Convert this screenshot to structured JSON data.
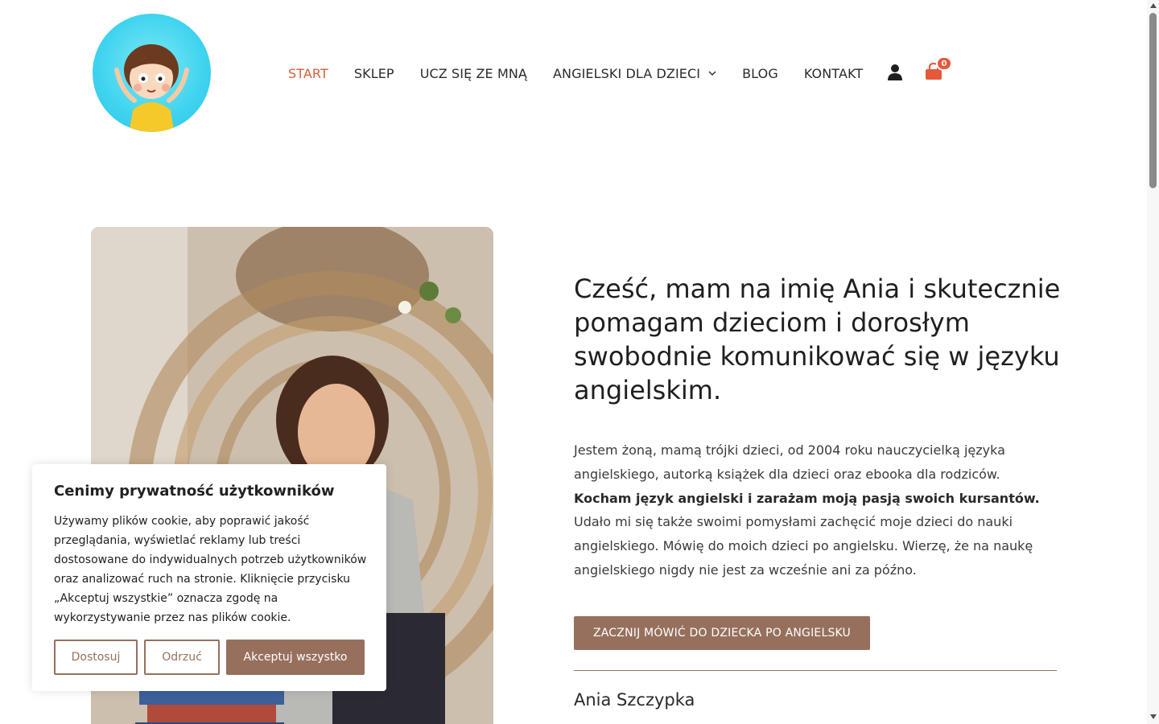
{
  "nav": {
    "items": [
      {
        "label": "START"
      },
      {
        "label": "SKLEP"
      },
      {
        "label": "UCZ SIĘ ZE MNĄ"
      },
      {
        "label": "ANGIELSKI DLA DZIECI"
      },
      {
        "label": "BLOG"
      },
      {
        "label": "KONTAKT"
      }
    ],
    "cart_count": "0"
  },
  "hero": {
    "headline": "Cześć, mam na imię Ania i skutecznie pomagam dzieciom i dorosłym swobodnie komunikować się w języku angielskim.",
    "bio_part1": "Jestem żoną, mamą trójki dzieci, od 2004 roku nauczycielką języka angielskiego, autorką książek dla dzieci oraz ebooka dla rodziców.",
    "bio_bold": "Kocham język angielski i zarażam moją pasją swoich kursantów.",
    "bio_part2": "Udało mi się także swoimi pomysłami zachęcić moje dzieci do nauki angielskiego. Mówię do moich dzieci po angielsku. Wierzę, że na naukę angielskiego nigdy nie jest za wcześnie ani za późno.",
    "cta_label": "ZACZNIJ MÓWIĆ DO DZIECKA PO ANGIELSKU",
    "signature": "Ania Szczypka"
  },
  "cookie": {
    "title": "Cenimy prywatność użytkowników",
    "text": "Używamy plików cookie, aby poprawić jakość przeglądania, wyświetlać reklamy lub treści dostosowane do indywidualnych potrzeb użytkowników oraz analizować ruch na stronie. Kliknięcie przycisku „Akceptuj wszystkie” oznacza zgodę na wykorzystywanie przez nas plików cookie.",
    "customize_label": "Dostosuj",
    "reject_label": "Odrzuć",
    "accept_label": "Akceptuj wszystko"
  },
  "colors": {
    "accent": "#96705d",
    "nav_active": "#d2603c",
    "cart": "#e4593a",
    "logo_bg": "#3fd3ef"
  },
  "icons": {
    "user": "user-icon",
    "cart": "shopping-bag-icon",
    "dropdown": "chevron-down-icon"
  }
}
